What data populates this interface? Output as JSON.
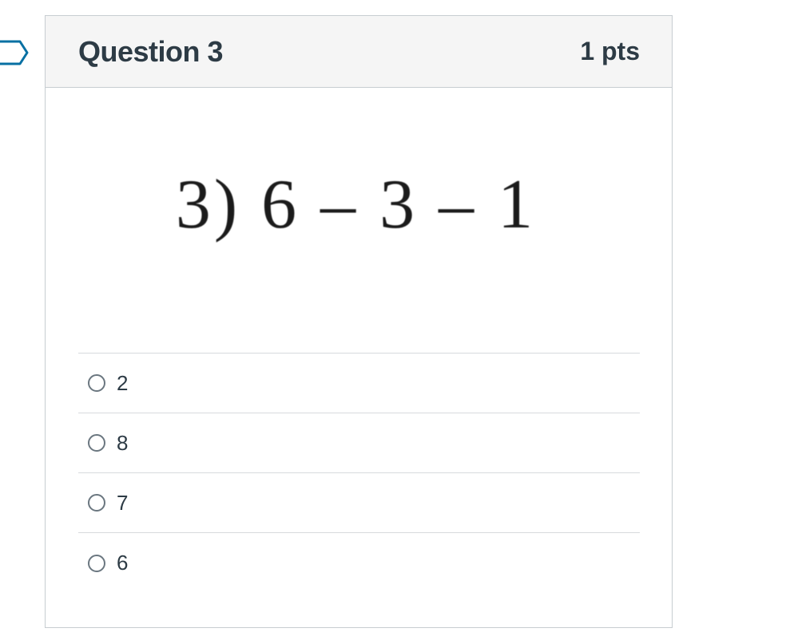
{
  "question": {
    "title": "Question 3",
    "points": "1 pts",
    "problem_text": "3)  6 – 3 – 1",
    "flag_icon": "bookmark-flag-icon"
  },
  "answers": [
    {
      "label": "2"
    },
    {
      "label": "8"
    },
    {
      "label": "7"
    },
    {
      "label": "6"
    }
  ],
  "colors": {
    "header_bg": "#f5f5f5",
    "border": "#c7cdd1",
    "text": "#2d3b45",
    "flag": "#0770a3"
  }
}
